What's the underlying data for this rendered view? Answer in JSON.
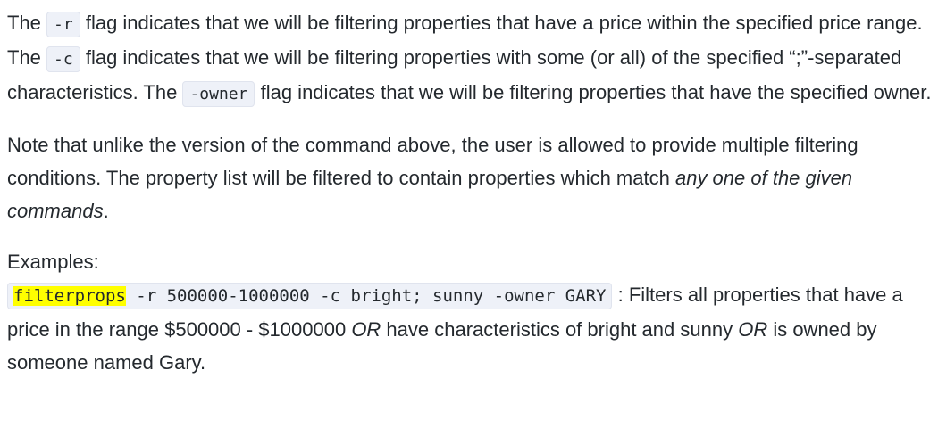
{
  "para1": {
    "t1": "The ",
    "code1": "-r",
    "t2": " flag indicates that we will be filtering properties that have a price within the specified price range. The ",
    "code2": "-c",
    "t3": " flag indicates that we will be filtering properties with some (or all) of the specified “;”-separated characteristics. The ",
    "code3": "-owner",
    "t4": " flag indicates that we will be filtering properties that have the specified owner."
  },
  "para2": {
    "t1": "Note that unlike the version of the command above, the user is allowed to provide multiple filtering conditions. The property list will be filtered to contain properties which match ",
    "em": "any one of the given commands",
    "t2": "."
  },
  "examples": {
    "label": "Examples:",
    "command": "filterprops",
    "args": " -r 500000-1000000 -c bright; sunny -owner GARY",
    "t1": " : Filters all properties that have a price in the range $500000 - $1000000 ",
    "or1": "OR",
    "t2": " have characteristics of bright and sunny ",
    "or2": "OR",
    "t3": " is owned by someone named Gary."
  }
}
